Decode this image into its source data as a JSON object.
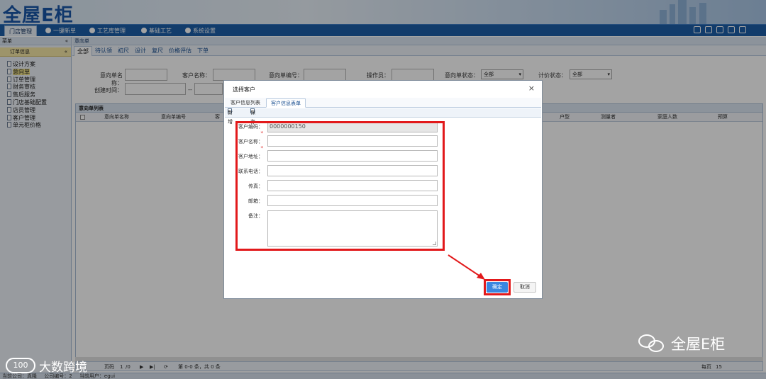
{
  "header": {
    "logo_text": "全屋E柜"
  },
  "topnav": {
    "tabs": [
      {
        "label": "门店管理"
      },
      {
        "label": "一键新单"
      },
      {
        "label": "工艺库管理"
      },
      {
        "label": "基础工艺"
      },
      {
        "label": "系统设置"
      }
    ]
  },
  "sidebar": {
    "head": "菜单",
    "collapse_glyph": "«",
    "group": "订单信息",
    "group_glyph": "«",
    "items": [
      {
        "label": "设计方案"
      },
      {
        "label": "意向单"
      },
      {
        "label": "订单管理"
      },
      {
        "label": "财务审核"
      },
      {
        "label": "售后服务"
      },
      {
        "label": "门店基础配置"
      },
      {
        "label": "店员管理"
      },
      {
        "label": "客户管理"
      },
      {
        "label": "单元柜价格"
      }
    ]
  },
  "main": {
    "breadcrumb": "意向单",
    "subtabs": [
      {
        "label": "全部"
      },
      {
        "label": "待认领"
      },
      {
        "label": "初尺"
      },
      {
        "label": "设计"
      },
      {
        "label": "复尺"
      },
      {
        "label": "价格评估"
      },
      {
        "label": "下单"
      }
    ],
    "filters": {
      "intent_name": "意向单名称：",
      "customer_name": "客户名称：",
      "intent_no": "意向单编号：",
      "operator": "操作员：",
      "intent_status": "意向单状态：",
      "intent_status_value": "全部",
      "price_status": "计价状态：",
      "price_status_value": "全部",
      "created_time": "创建时间：",
      "range_sep": "--"
    },
    "list_title": "意向单列表",
    "columns": [
      "意向单名称",
      "意向单编号",
      "客",
      "户型",
      "测量者",
      "家庭人数",
      "预算"
    ],
    "pager": {
      "page_label": "页码",
      "page": "1",
      "total": "/0",
      "summary": "第 0-0 条，共 0 条",
      "per_page_label": "每页",
      "per_page": "15"
    }
  },
  "statusbar": {
    "company": "当前公司：真隆",
    "company_no": "公司编号：2",
    "user": "当前用户：egui"
  },
  "modal": {
    "title": "选择客户",
    "close": "×",
    "tabs": [
      {
        "label": "客户信息列表"
      },
      {
        "label": "客户信息表单"
      }
    ],
    "toolbar": {
      "new": "新增",
      "save": "保存"
    },
    "fields": [
      {
        "label": "客户编码：",
        "required": true,
        "value": "0000000150"
      },
      {
        "label": "客户名称：",
        "required": true,
        "value": ""
      },
      {
        "label": "客户地址：",
        "required": false,
        "value": ""
      },
      {
        "label": "联系电话：",
        "required": false,
        "value": ""
      },
      {
        "label": "传真：",
        "required": false,
        "value": ""
      },
      {
        "label": "邮箱：",
        "required": false,
        "value": ""
      },
      {
        "label": "备注：",
        "required": false,
        "value": ""
      }
    ],
    "required_mark": "*",
    "ok": "确定",
    "cancel": "取消"
  },
  "watermarks": {
    "right": "全屋E柜",
    "left": "大数跨境",
    "left_mark": "100"
  },
  "colors": {
    "accent": "#1d5fa8",
    "highlight": "#e2191b",
    "ok_button": "#3a86e0"
  }
}
